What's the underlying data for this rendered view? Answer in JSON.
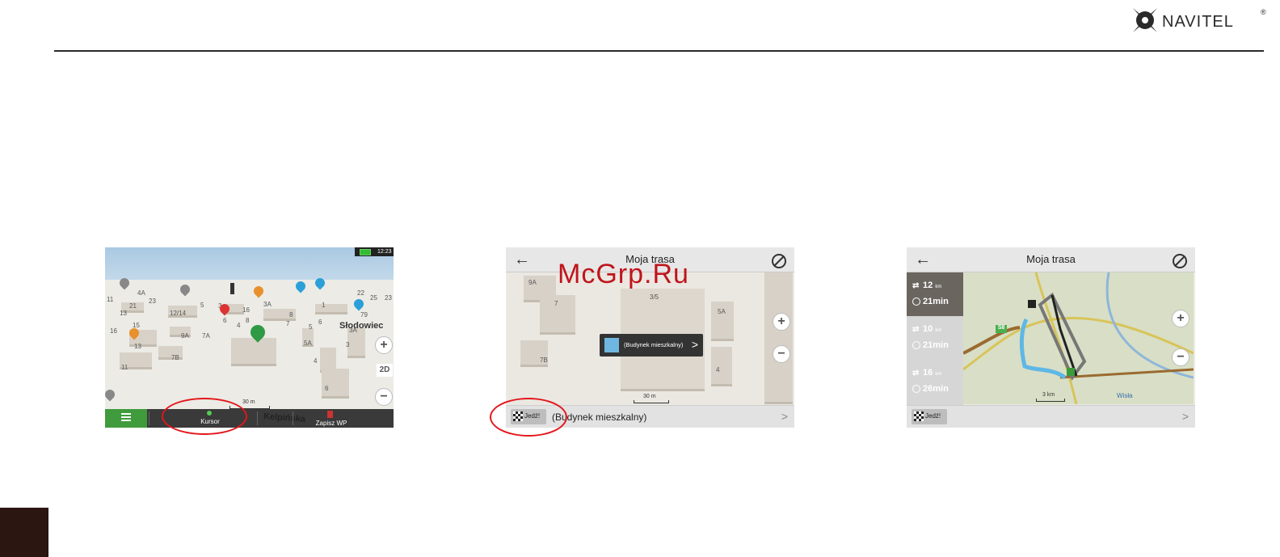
{
  "brand": {
    "name": "NAVITEL",
    "registered": "®"
  },
  "screen1": {
    "status_time": "12:23",
    "street_label": "Słodowiec",
    "street_bottom": "Kelpińska",
    "scale": "30 m",
    "zoom_in": "+",
    "zoom_out": "−",
    "view_mode": "2D",
    "cursor_label": "Kursor",
    "save_label": "Zapisz WP",
    "house_numbers": [
      "4A",
      "11",
      "21",
      "23",
      "13",
      "12/14",
      "5",
      "3",
      "16",
      "3A",
      "1",
      "22",
      "25",
      "23",
      "8",
      "79",
      "16",
      "15",
      "6",
      "7",
      "5",
      "9A",
      "7A",
      "4",
      "8",
      "6",
      "3",
      "3A",
      "13",
      "5A",
      "4",
      "11",
      "7B",
      "6"
    ]
  },
  "screen2": {
    "title": "Moja trasa",
    "back": "←",
    "tooltip_text": "(Budynek mieszkalny)",
    "tooltip_arrow": ">",
    "go_label": "Jedź!",
    "address": "(Budynek mieszkalny)",
    "chevron": ">",
    "scale": "30 m",
    "watermark": "McGrp.Ru",
    "house_numbers": [
      "9A",
      "7",
      "3/5",
      "5A",
      "7B",
      "4"
    ]
  },
  "screen3": {
    "title": "Moja trasa",
    "back": "←",
    "go_label": "Jedź!",
    "chevron": ">",
    "routes": [
      {
        "distance": "12",
        "unit": "km",
        "duration": "21min",
        "selected": true
      },
      {
        "distance": "10",
        "unit": "km",
        "duration": "21min",
        "selected": false
      },
      {
        "distance": "16",
        "unit": "km",
        "duration": "26min",
        "selected": false
      }
    ],
    "road_badge": "S8",
    "river": "Wisła",
    "scale": "3 km"
  }
}
